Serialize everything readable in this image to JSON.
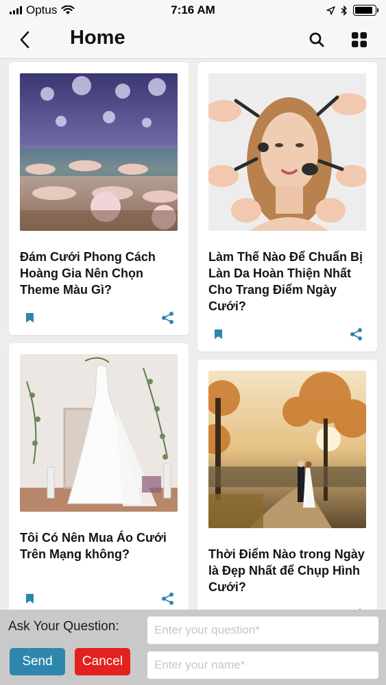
{
  "status_bar": {
    "carrier": "Optus",
    "time": "7:16 AM",
    "battery_level": 0.9
  },
  "header": {
    "title": "Home",
    "back_icon": "chevron-left-icon",
    "search_icon": "search-icon",
    "grid_icon": "grid-icon"
  },
  "cards": [
    {
      "title": "Đám Cưới Phong Cách Hoàng Gia Nên Chọn Theme Màu Gì?",
      "image": "wedding-banquet-hall"
    },
    {
      "title": "Làm Thế Nào Để Chuẩn Bị Làn Da Hoàn Thiện Nhất Cho Trang Điểm Ngày Cưới?",
      "image": "makeup-brushes-bride"
    },
    {
      "title": "Tôi Có Nên Mua Áo Cưới Trên Mạng không?",
      "image": "wedding-dress-hanging"
    },
    {
      "title": "Thời Điểm Nào trong Ngày là Đẹp Nhất để Chụp Hình Cưới?",
      "image": "couple-autumn-sunset"
    }
  ],
  "colors": {
    "accent": "#2f86ac",
    "cancel": "#e3211e",
    "panel_bg": "#c9c9c9"
  },
  "question_panel": {
    "label": "Ask Your Question:",
    "question_placeholder": "Enter your question*",
    "name_placeholder": "Enter your name*",
    "send_label": "Send",
    "cancel_label": "Cancel"
  }
}
